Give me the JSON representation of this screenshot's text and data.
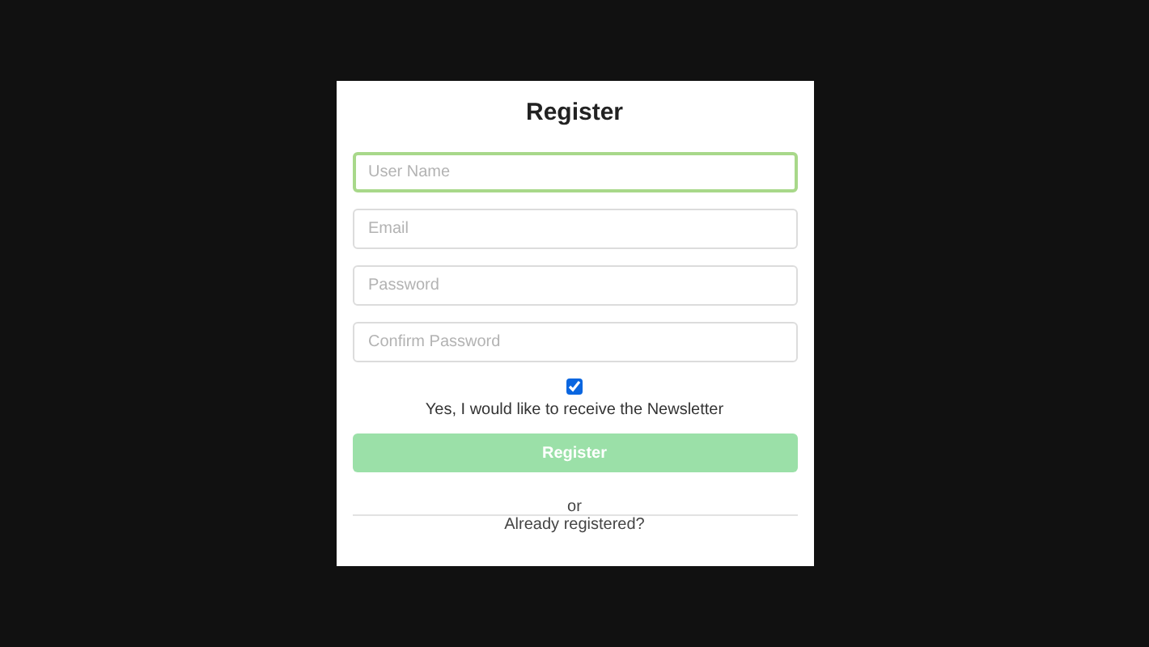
{
  "title": "Register",
  "fields": [
    {
      "placeholder": "User Name",
      "focused": true
    },
    {
      "placeholder": "Email",
      "focused": false
    },
    {
      "placeholder": "Password",
      "focused": false
    },
    {
      "placeholder": "Confirm Password",
      "focused": false
    }
  ],
  "newsletter": {
    "checked": true,
    "label": "Yes, I would like to receive the Newsletter"
  },
  "submit": {
    "label": "Register"
  },
  "separator": "or",
  "login_link": "Already registered?"
}
